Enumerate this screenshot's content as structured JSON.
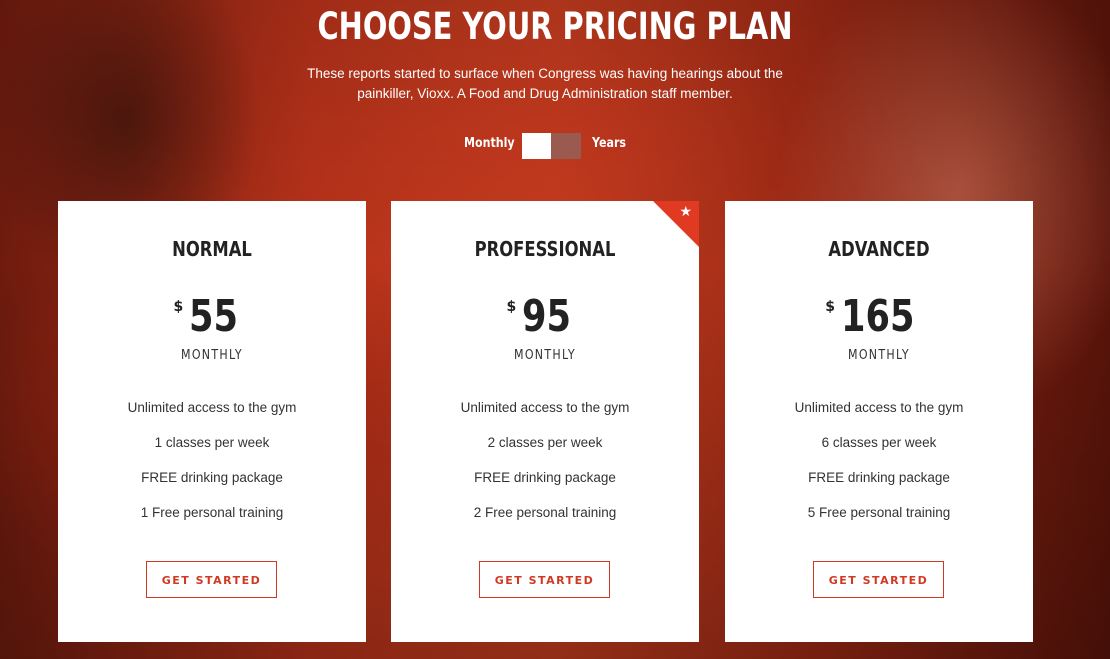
{
  "header": {
    "title": "CHOOSE YOUR PRICING PLAN",
    "subtitle": "These reports started to surface when Congress was having hearings about the painkiller, Vioxx. A Food and Drug Administration staff member."
  },
  "billing_toggle": {
    "left_label": "Monthly",
    "right_label": "Years",
    "selected": "Monthly"
  },
  "plans": [
    {
      "name": "NORMAL",
      "currency": "$",
      "price": "55",
      "period": "MONTHLY",
      "features": [
        "Unlimited access to the gym",
        "1 classes per week",
        "FREE drinking package",
        "1 Free personal training"
      ],
      "cta": "GET STARTED",
      "featured": false
    },
    {
      "name": "PROFESSIONAL",
      "currency": "$",
      "price": "95",
      "period": "MONTHLY",
      "features": [
        "Unlimited access to the gym",
        "2 classes per week",
        "FREE drinking package",
        "2 Free personal training"
      ],
      "cta": "GET STARTED",
      "featured": true,
      "badge_icon": "star-icon"
    },
    {
      "name": "ADVANCED",
      "currency": "$",
      "price": "165",
      "period": "MONTHLY",
      "features": [
        "Unlimited access to the gym",
        "6 classes per week",
        "FREE drinking package",
        "5 Free personal training"
      ],
      "cta": "GET STARTED",
      "featured": false
    }
  ],
  "colors": {
    "accent": "#d03a22",
    "badge": "#e03a22",
    "card_background": "#ffffff",
    "text_dark": "#222222"
  }
}
